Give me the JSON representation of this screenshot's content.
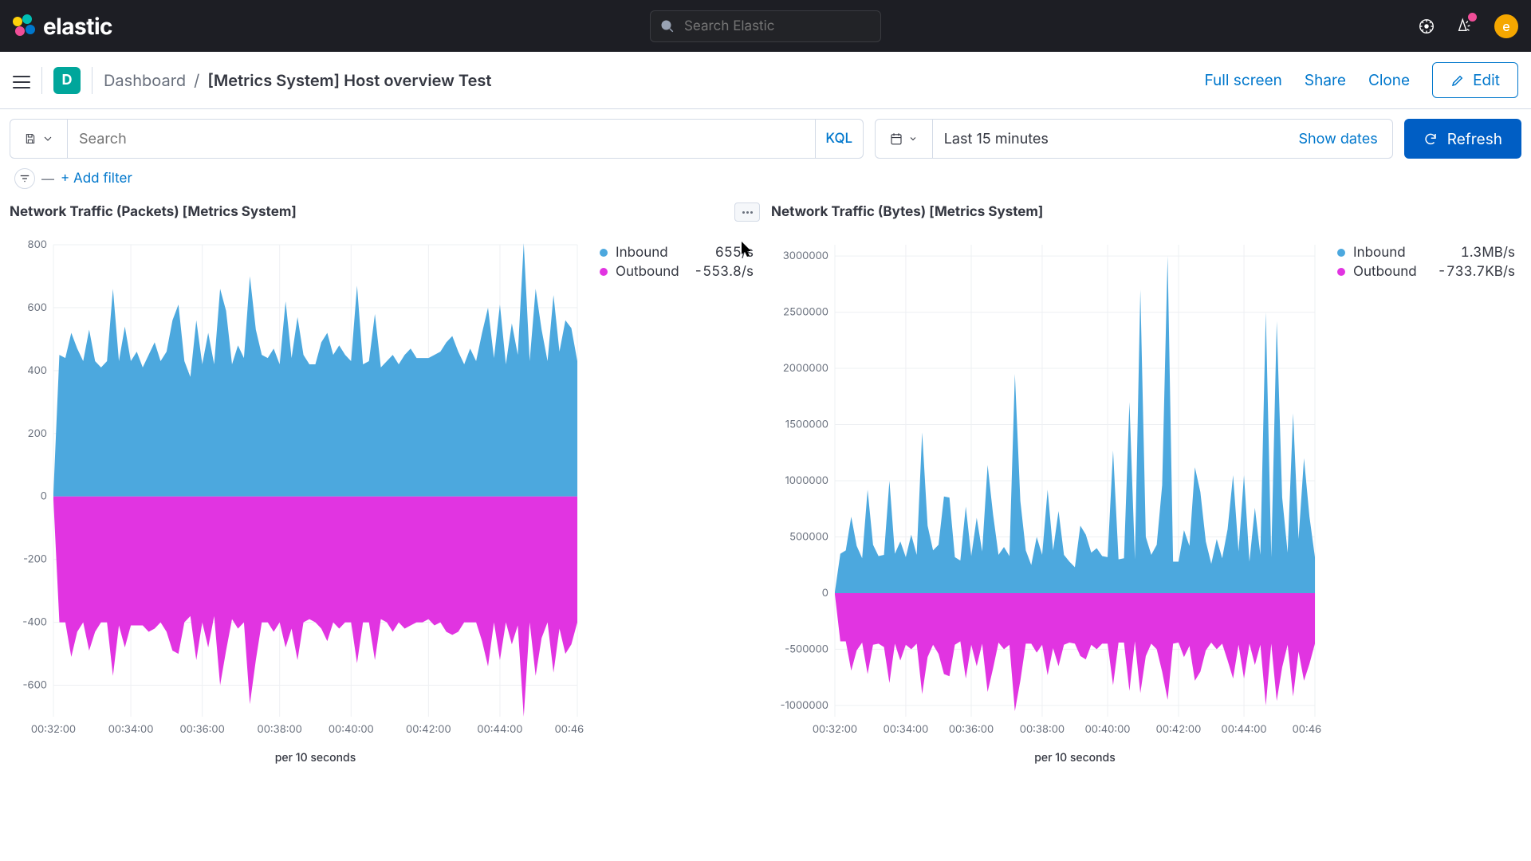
{
  "brand": {
    "text": "elastic"
  },
  "global_search": {
    "placeholder": "Search Elastic"
  },
  "avatar_initial": "e",
  "breadcrumb": {
    "app_initial": "D",
    "root": "Dashboard",
    "current": "[Metrics System] Host overview Test"
  },
  "page_actions": {
    "full_screen": "Full screen",
    "share": "Share",
    "clone": "Clone",
    "edit": "Edit"
  },
  "query_bar": {
    "search_placeholder": "Search",
    "kql_label": "KQL",
    "date_range": "Last 15 minutes",
    "show_dates": "Show dates",
    "refresh": "Refresh"
  },
  "filter_bar": {
    "add_filter": "+ Add filter"
  },
  "panels": [
    {
      "title": "Network Traffic (Packets) [Metrics System]"
    },
    {
      "title": "Network Traffic (Bytes) [Metrics System]"
    }
  ],
  "colors": {
    "inbound": "#4ca8de",
    "outbound": "#e134e1"
  },
  "chart_data": [
    {
      "type": "area",
      "title": "Network Traffic (Packets) [Metrics System]",
      "xlabel": "per 10 seconds",
      "ylabel": "",
      "ylim": [
        -700,
        800
      ],
      "x_ticks": [
        "00:32:00",
        "00:34:00",
        "00:36:00",
        "00:38:00",
        "00:40:00",
        "00:42:00",
        "00:44:00",
        "00:46:00"
      ],
      "y_ticks": [
        -600,
        -400,
        -200,
        0,
        200,
        400,
        600,
        800
      ],
      "legend": [
        {
          "name": "Inbound",
          "value": "655/s"
        },
        {
          "name": "Outbound",
          "value": "-553.8/s"
        }
      ],
      "series": [
        {
          "name": "Inbound",
          "values": [
            10,
            450,
            440,
            520,
            470,
            430,
            530,
            430,
            410,
            430,
            660,
            430,
            540,
            430,
            460,
            410,
            450,
            490,
            430,
            460,
            560,
            610,
            430,
            380,
            560,
            420,
            520,
            420,
            660,
            590,
            420,
            480,
            440,
            700,
            530,
            450,
            440,
            470,
            420,
            620,
            440,
            570,
            450,
            420,
            420,
            490,
            520,
            450,
            480,
            450,
            430,
            670,
            420,
            430,
            580,
            410,
            430,
            450,
            420,
            450,
            470,
            440,
            440,
            440,
            450,
            460,
            490,
            510,
            460,
            420,
            470,
            430,
            520,
            600,
            440,
            610,
            420,
            550,
            450,
            805,
            430,
            660,
            530,
            430,
            640,
            460,
            560,
            535,
            430
          ]
        },
        {
          "name": "Outbound",
          "values": [
            -10,
            -400,
            -400,
            -510,
            -430,
            -400,
            -490,
            -430,
            -400,
            -400,
            -570,
            -410,
            -480,
            -410,
            -410,
            -410,
            -430,
            -420,
            -400,
            -430,
            -490,
            -500,
            -400,
            -380,
            -520,
            -400,
            -480,
            -380,
            -600,
            -490,
            -390,
            -420,
            -400,
            -660,
            -520,
            -400,
            -400,
            -430,
            -400,
            -480,
            -420,
            -520,
            -400,
            -390,
            -400,
            -420,
            -460,
            -400,
            -420,
            -400,
            -400,
            -530,
            -400,
            -400,
            -520,
            -390,
            -400,
            -430,
            -400,
            -420,
            -410,
            -400,
            -400,
            -390,
            -410,
            -400,
            -430,
            -440,
            -430,
            -400,
            -400,
            -400,
            -460,
            -540,
            -400,
            -520,
            -400,
            -470,
            -410,
            -700,
            -400,
            -570,
            -450,
            -400,
            -560,
            -420,
            -500,
            -470,
            -400
          ]
        }
      ]
    },
    {
      "type": "area",
      "title": "Network Traffic (Bytes) [Metrics System]",
      "xlabel": "per 10 seconds",
      "ylabel": "",
      "ylim": [
        -1100000,
        3100000
      ],
      "x_ticks": [
        "00:32:00",
        "00:34:00",
        "00:36:00",
        "00:38:00",
        "00:40:00",
        "00:42:00",
        "00:44:00",
        "00:46:00"
      ],
      "y_ticks": [
        -1000000,
        -500000,
        0,
        500000,
        1000000,
        1500000,
        2000000,
        2500000,
        3000000
      ],
      "legend": [
        {
          "name": "Inbound",
          "value": "1.3MB/s"
        },
        {
          "name": "Outbound",
          "value": "-733.7KB/s"
        }
      ],
      "series": [
        {
          "name": "Inbound",
          "values": [
            10000,
            350000,
            380000,
            680000,
            420000,
            310000,
            920000,
            430000,
            330000,
            340000,
            1000000,
            350000,
            460000,
            320000,
            520000,
            340000,
            1430000,
            600000,
            380000,
            430000,
            860000,
            850000,
            320000,
            290000,
            770000,
            330000,
            670000,
            370000,
            1140000,
            700000,
            340000,
            410000,
            330000,
            1950000,
            820000,
            380000,
            250000,
            500000,
            340000,
            920000,
            380000,
            730000,
            340000,
            280000,
            230000,
            600000,
            520000,
            360000,
            400000,
            330000,
            320000,
            1270000,
            300000,
            310000,
            1700000,
            300000,
            2700000,
            500000,
            340000,
            430000,
            960000,
            3000000,
            280000,
            280000,
            560000,
            420000,
            1120000,
            900000,
            460000,
            260000,
            480000,
            310000,
            570000,
            1050000,
            370000,
            1050000,
            280000,
            760000,
            340000,
            2500000,
            320000,
            2420000,
            850000,
            360000,
            1600000,
            480000,
            1200000,
            680000,
            320000
          ]
        },
        {
          "name": "Outbound",
          "values": [
            -10000,
            -430000,
            -430000,
            -690000,
            -510000,
            -440000,
            -720000,
            -460000,
            -450000,
            -480000,
            -800000,
            -450000,
            -600000,
            -460000,
            -500000,
            -450000,
            -900000,
            -570000,
            -460000,
            -540000,
            -720000,
            -740000,
            -460000,
            -430000,
            -760000,
            -460000,
            -650000,
            -450000,
            -880000,
            -670000,
            -440000,
            -500000,
            -460000,
            -1050000,
            -780000,
            -450000,
            -450000,
            -530000,
            -460000,
            -730000,
            -490000,
            -650000,
            -460000,
            -440000,
            -450000,
            -560000,
            -590000,
            -460000,
            -500000,
            -450000,
            -450000,
            -820000,
            -440000,
            -440000,
            -870000,
            -430000,
            -890000,
            -560000,
            -450000,
            -500000,
            -700000,
            -950000,
            -450000,
            -440000,
            -570000,
            -470000,
            -780000,
            -700000,
            -510000,
            -440000,
            -500000,
            -450000,
            -600000,
            -760000,
            -460000,
            -760000,
            -450000,
            -640000,
            -460000,
            -1000000,
            -450000,
            -960000,
            -660000,
            -460000,
            -920000,
            -520000,
            -780000,
            -630000,
            -450000
          ]
        }
      ]
    }
  ]
}
